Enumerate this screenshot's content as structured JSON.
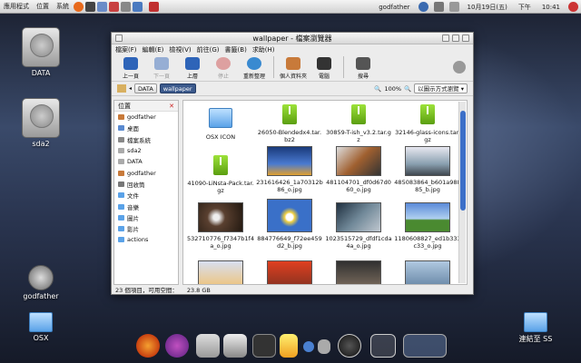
{
  "panel": {
    "menus": [
      "應用程式",
      "位置",
      "系統"
    ],
    "user": "godfather",
    "date": "10月19日(五)",
    "ampm": "下午",
    "time": "10:41"
  },
  "desktop": {
    "icons": [
      {
        "label": "DATA",
        "icon": "hard-drive-icon"
      },
      {
        "label": "sda2",
        "icon": "hard-drive-icon"
      },
      {
        "label": "godfather",
        "icon": "home-icon"
      },
      {
        "label": "OSX",
        "icon": "folder-icon"
      },
      {
        "label": "連結至 SS",
        "icon": "folder-icon"
      }
    ]
  },
  "window": {
    "title": "wallpaper - 檔案瀏覽器",
    "menu": [
      "檔案(F)",
      "編輯(E)",
      "檢視(V)",
      "前往(G)",
      "書籤(B)",
      "求助(H)"
    ],
    "toolbar": {
      "back": "上一頁",
      "forward": "下一頁",
      "up": "上層",
      "stop": "停止",
      "reload": "重新整理",
      "home": "個人資料夾",
      "computer": "電腦",
      "search": "搜尋"
    },
    "location": {
      "crumbs": [
        "DATA",
        "wallpaper"
      ],
      "zoom": "100%",
      "view_mode": "以圖示方式瀏覽"
    },
    "sidebar": {
      "header": "位置",
      "items": [
        "godfather",
        "桌面",
        "檔案系統",
        "sda2",
        "DATA",
        "godfather",
        "回收筒",
        "文件",
        "音樂",
        "圖片",
        "影片",
        "actions"
      ]
    },
    "files": [
      {
        "name": "OSX ICON",
        "type": "folder"
      },
      {
        "name": "26050-Blendedx4.tar.bz2",
        "type": "archive"
      },
      {
        "name": "30859-T-ish_v3.2.tar.gz",
        "type": "archive"
      },
      {
        "name": "32146-glass-icons.tar.gz",
        "type": "archive"
      },
      {
        "name": "41090-LiNsta-Pack.tar.gz",
        "type": "archive"
      },
      {
        "name": "231616426_1a70312b86_o.jpg",
        "type": "image"
      },
      {
        "name": "481104701_df0d67d060_o.jpg",
        "type": "image"
      },
      {
        "name": "485083864_b601a98885_b.jpg",
        "type": "image"
      },
      {
        "name": "532710776_f7347b1f4a_o.jpg",
        "type": "image"
      },
      {
        "name": "884776649_f72ee459d2_b.jpg",
        "type": "image"
      },
      {
        "name": "1023515729_dfdf1cda4a_o.jpg",
        "type": "image"
      },
      {
        "name": "1180608827_ed1b333c33_o.jpg",
        "type": "image"
      }
    ],
    "status": {
      "items": "23 個項目，可用空間：",
      "free": "23.8 GB"
    }
  },
  "colors": {
    "accent": "#3c6fc8",
    "archive_green": "#7ac520",
    "folder_blue": "#5aa2e8"
  }
}
